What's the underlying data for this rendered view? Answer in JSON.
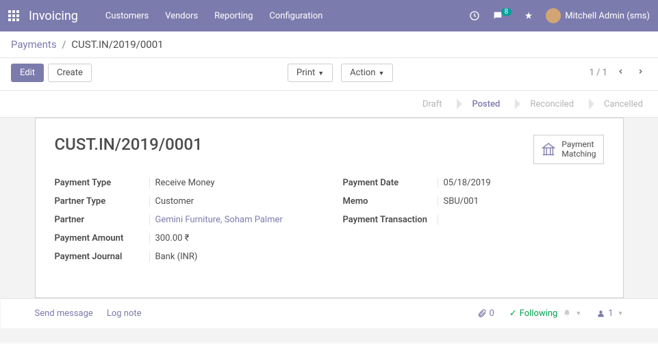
{
  "topnav": {
    "app_name": "Invoicing",
    "menus": [
      "Customers",
      "Vendors",
      "Reporting",
      "Configuration"
    ],
    "chat_badge": "8",
    "user_name": "Mitchell Admin (sms)"
  },
  "breadcrumb": {
    "root": "Payments",
    "current": "CUST.IN/2019/0001"
  },
  "buttons": {
    "edit": "Edit",
    "create": "Create",
    "print": "Print",
    "action": "Action"
  },
  "pager": {
    "range": "1 / 1"
  },
  "status": {
    "steps": [
      "Draft",
      "Posted",
      "Reconciled",
      "Cancelled"
    ],
    "active_index": 1
  },
  "sheet": {
    "title": "CUST.IN/2019/0001",
    "stat_button": {
      "line1": "Payment",
      "line2": "Matching"
    },
    "left_fields": [
      {
        "label": "Payment Type",
        "value": "Receive Money",
        "link": false
      },
      {
        "label": "Partner Type",
        "value": "Customer",
        "link": false
      },
      {
        "label": "Partner",
        "value": "Gemini Furniture, Soham Palmer",
        "link": true
      },
      {
        "label": "Payment Amount",
        "value": "300.00 ₹",
        "link": false
      },
      {
        "label": "Payment Journal",
        "value": "Bank (INR)",
        "link": false
      }
    ],
    "right_fields": [
      {
        "label": "Payment Date",
        "value": "05/18/2019"
      },
      {
        "label": "Memo",
        "value": "SBU/001"
      },
      {
        "label": "Payment Transaction",
        "value": ""
      }
    ]
  },
  "chatter": {
    "send": "Send message",
    "log": "Log note",
    "attach_count": "0",
    "following": "Following",
    "follower_count": "1"
  }
}
